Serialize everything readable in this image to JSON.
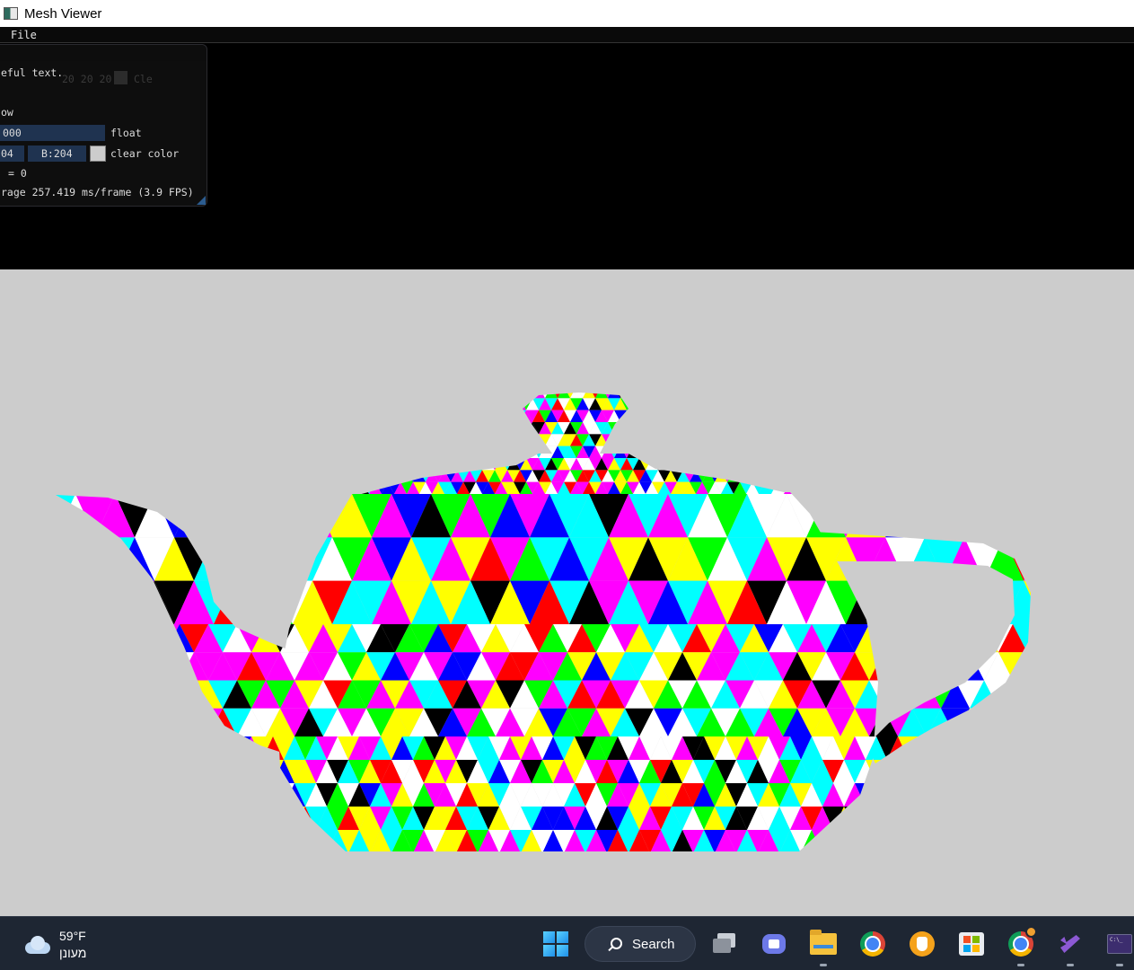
{
  "window": {
    "title": "Mesh Viewer",
    "menu": [
      "File"
    ]
  },
  "imgui": {
    "line_text": "eful text.",
    "faded_values": "20 20 20",
    "faded_button": "Cle",
    "checkbox_line": "ow",
    "slider_value": "000",
    "slider_label": "float",
    "color_g": "04",
    "color_b": "B:204",
    "color_label": "clear color",
    "counter": "= 0",
    "fps": "rage 257.419 ms/frame (3.9 FPS)",
    "clear_color": "#cccccc"
  },
  "taskbar": {
    "weather_temp": "59°F",
    "weather_cond": "מעונן",
    "search_label": "Search",
    "pinned_icons": [
      "start-icon",
      "search-icon",
      "task-view-icon",
      "chat-icon",
      "file-explorer-icon",
      "chrome-icon",
      "vpn-icon",
      "store-icon",
      "chrome-profile-icon",
      "visual-studio-icon",
      "terminal-icon"
    ]
  },
  "mesh": {
    "palette": [
      "#ff00ff",
      "#00ffff",
      "#ffff00",
      "#ff0000",
      "#00ff00",
      "#0000ff",
      "#ffffff",
      "#000000",
      "#ffffff",
      "#ff00ff",
      "#00ffff",
      "#ffff00"
    ]
  }
}
